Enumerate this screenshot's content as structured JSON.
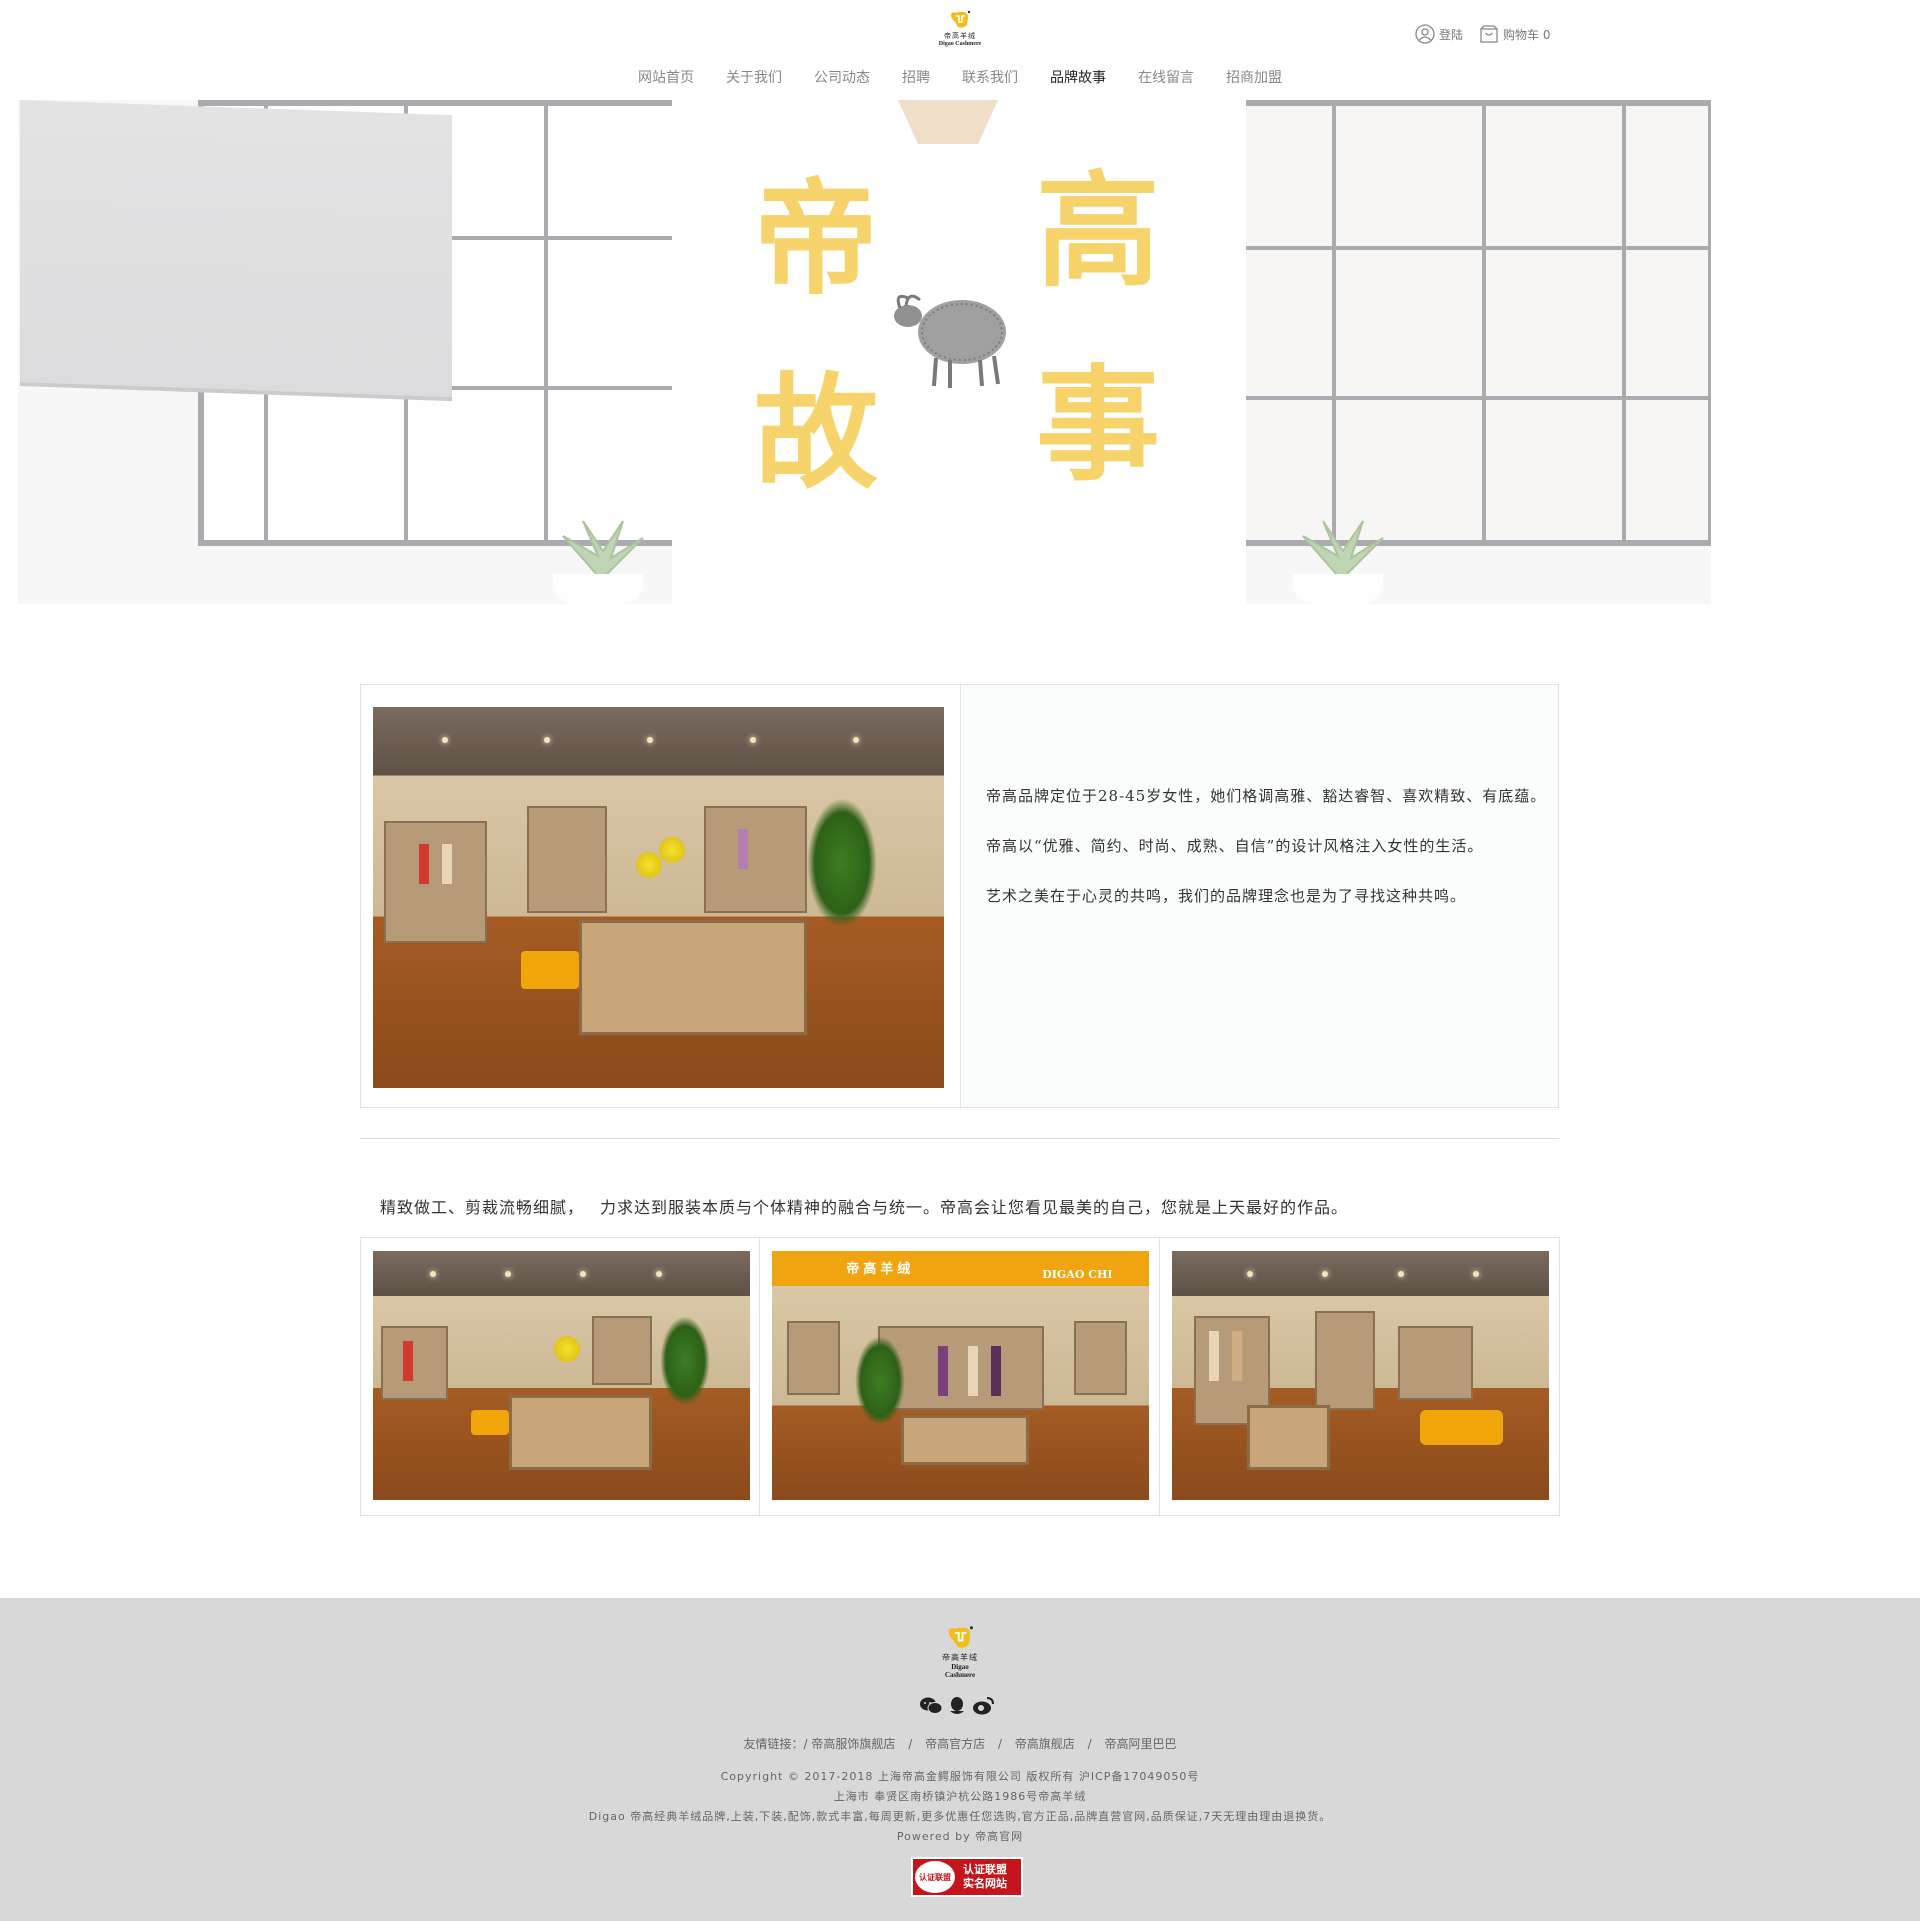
{
  "header": {
    "logo_cn": "帝高羊绒",
    "logo_en": "Digao Cashmere",
    "login": "登陆",
    "cart": "购物车 0"
  },
  "nav": {
    "items": [
      "网站首页",
      "关于我们",
      "公司动态",
      "招聘",
      "联系我们",
      "品牌故事",
      "在线留言",
      "招商加盟"
    ],
    "active_index": 5
  },
  "hero": {
    "chars": [
      "帝",
      "高",
      "故",
      "事"
    ]
  },
  "intro": {
    "paragraphs": [
      "帝高品牌定位于28-45岁女性，她们格调高雅、豁达睿智、喜欢精致、有底蕴。",
      "帝高以“优雅、简约、时尚、成熟、自信”的设计风格注入女性的生活。",
      "艺术之美在于心灵的共鸣，我们的品牌理念也是为了寻找这种共鸣。"
    ]
  },
  "tagline": {
    "part1": "精致做工、剪裁流畅细腻，",
    "part2": "力求达到服装本质与个体精神的融合与统一。帝高会让您看见最美的自己，您就是上天最好的作品。"
  },
  "gallery": {
    "sign_cn": "帝高羊绒",
    "sign_en": "DIGAO CHI"
  },
  "footer": {
    "logo_cn": "帝高羊绒",
    "logo_en": "Digao Cashmere",
    "friend_label": "友情链接：/",
    "links": [
      "帝高服饰旗舰店",
      "帝高官方店",
      "帝高旗舰店",
      "帝高阿里巴巴"
    ],
    "copyright": "Copyright © 2017-2018 上海帝高金鳄服饰有限公司 版权所有 沪ICP备17049050号",
    "address": "上海市 奉贤区南桥镇沪杭公路1986号帝高羊绒",
    "description": "Digao 帝高经典羊绒品牌,上装,下装,配饰,款式丰富,每周更新,更多优惠任您选购,官方正品,品牌直营官网,品质保证,7天无理由理由退换货。",
    "powered": "Powered by 帝高官网",
    "badge_seal": "认证联盟",
    "badge_line1": "认证联盟",
    "badge_line2": "实名网站"
  },
  "colors": {
    "accent_yellow": "#f2bd1d",
    "footer_bg": "#d8d8d8",
    "border": "#d8e6e4",
    "badge_red": "#c4151c"
  }
}
